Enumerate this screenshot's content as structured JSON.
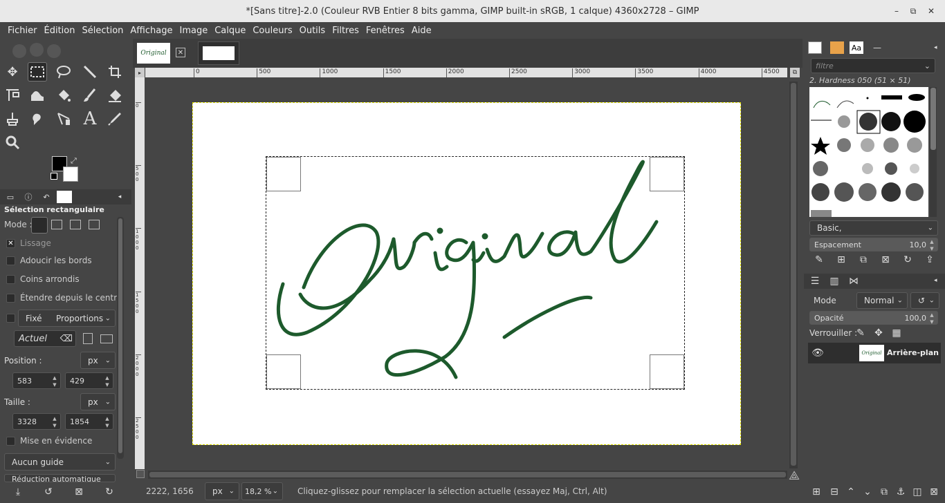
{
  "window": {
    "title": "*[Sans titre]-2.0 (Couleur RVB Entier 8 bits gamma, GIMP built-in sRGB, 1 calque) 4360x2728 – GIMP",
    "minimize": "–",
    "maximize": "⧉",
    "close": "✕"
  },
  "menu": [
    "Fichier",
    "Édition",
    "Sélection",
    "Affichage",
    "Image",
    "Calque",
    "Couleurs",
    "Outils",
    "Filtres",
    "Fenêtres",
    "Aide"
  ],
  "tool_options": {
    "title": "Sélection rectangulaire",
    "mode_label": "Mode :",
    "antialias": "Lissage",
    "feather": "Adoucir les bords",
    "rounded": "Coins arrondis",
    "expand": "Étendre depuis le centre",
    "fixed": "Fixé",
    "fixed_option": "Proportions",
    "current": "Actuel",
    "position_label": "Position :",
    "position_unit": "px",
    "pos_x": "583",
    "pos_y": "429",
    "size_label": "Taille :",
    "size_unit": "px",
    "width": "3328",
    "height": "1854",
    "highlight": "Mise en évidence",
    "guides": "Aucun guide",
    "auto_shrink": "Réduction automatique"
  },
  "ruler": {
    "h_ticks": [
      "0",
      "500",
      "1000",
      "1500",
      "2000",
      "2500",
      "3000",
      "3500",
      "4000",
      "4500"
    ],
    "v_ticks": [
      "0",
      "5 0 0",
      "1 0 0 0",
      "1 5 0 0",
      "2 0 0 0",
      "2 5 0 0"
    ]
  },
  "canvas": {
    "signature_text": "Original",
    "signature_color": "#1d5a2c"
  },
  "status": {
    "coords": "2222, 1656",
    "unit": "px",
    "zoom": "18,2 %",
    "message": "Cliquez-glissez pour remplacer la sélection actuelle (essayez Maj, Ctrl, Alt)"
  },
  "brushes": {
    "filter_placeholder": "filtre",
    "current": "2. Hardness 050 (51 × 51)",
    "preset": "Basic,",
    "spacing_label": "Espacement",
    "spacing_value": "10,0"
  },
  "layers": {
    "mode_label": "Mode",
    "mode_value": "Normal",
    "opacity_label": "Opacité",
    "opacity_value": "100,0",
    "lock_label": "Verrouiller :",
    "items": [
      {
        "name": "Arrière-plan",
        "thumb_text": "Original"
      }
    ]
  }
}
